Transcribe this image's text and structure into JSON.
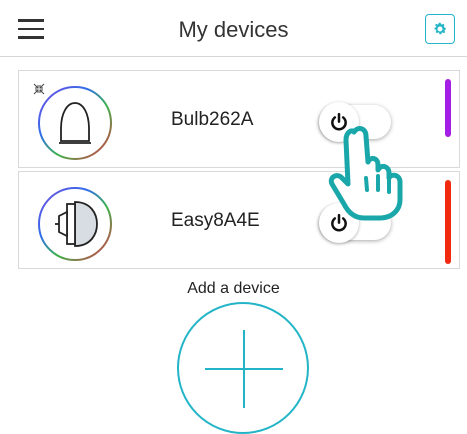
{
  "header": {
    "title": "My devices",
    "menu_icon": "hamburger-menu-icon",
    "settings_icon": "gear-icon",
    "accent_color": "#23b5c7"
  },
  "devices": [
    {
      "name": "Bulb262A",
      "icon": "bulb-dome-icon",
      "power_icon": "power-icon",
      "status_color": "#a51ee6",
      "shrink_icon": "collapse-arrows-icon"
    },
    {
      "name": "Easy8A4E",
      "icon": "bulb-side-icon",
      "power_icon": "power-icon",
      "status_color": "#f22a10"
    }
  ],
  "add_device": {
    "label": "Add a device",
    "icon": "plus-icon"
  },
  "overlay": {
    "icon": "tap-hand-icon"
  }
}
